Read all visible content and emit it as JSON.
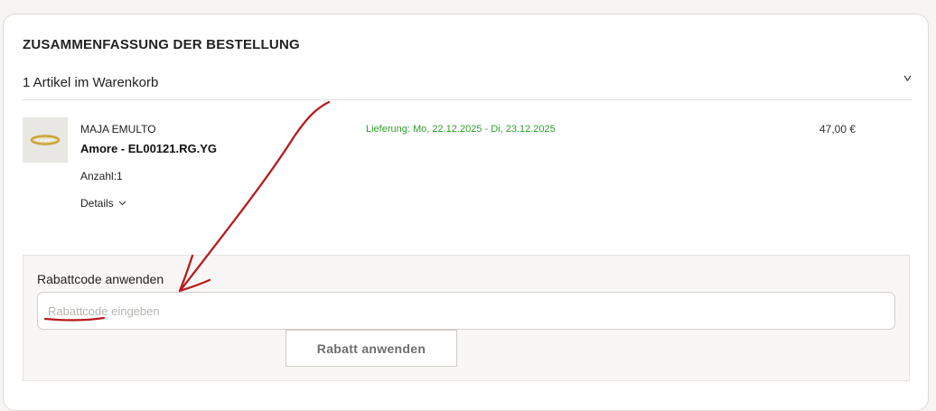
{
  "summary": {
    "title": "ZUSAMMENFASSUNG DER BESTELLUNG",
    "cart_count": "1 Artikel im Warenkorb",
    "chevron_icon": "chevron-down-icon"
  },
  "item": {
    "brand": "MAJA EMULTO",
    "name": "Amore - EL00121.RG.YG",
    "quantity": "Anzahl:1",
    "details_label": "Details",
    "delivery": "Lieferung: Mo, 22.12.2025 - Di, 23.12.2025",
    "price": "47,00 €",
    "image_icon": "ring-product-image"
  },
  "discount": {
    "label": "Rabattcode anwenden",
    "placeholder": "Rabattcode eingeben",
    "value": "",
    "button_label": "Rabatt anwenden"
  },
  "colors": {
    "delivery_green": "#2f9e2f",
    "annotation_red": "#b81c1c",
    "panel_bg": "#f8f7f5"
  }
}
